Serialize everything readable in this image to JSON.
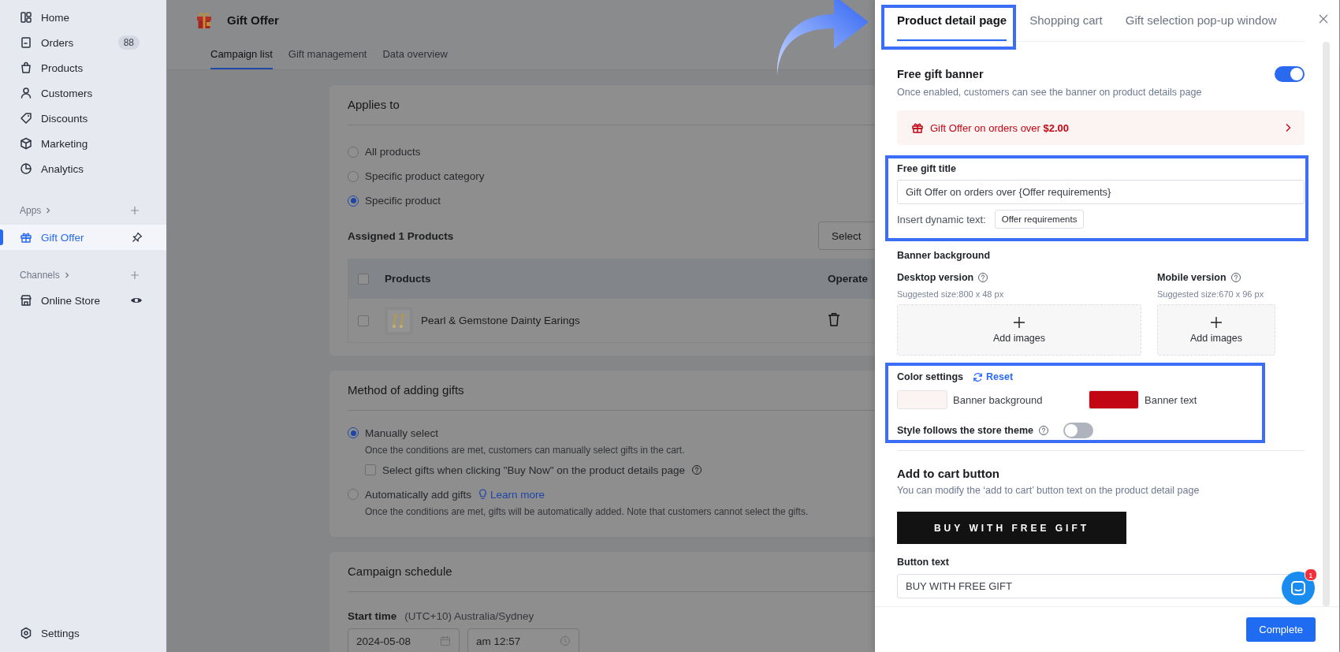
{
  "sidebar": {
    "nav": [
      {
        "label": "Home",
        "selected": false
      },
      {
        "label": "Orders",
        "selected": false,
        "badge": "88"
      },
      {
        "label": "Products",
        "selected": false
      },
      {
        "label": "Customers",
        "selected": false
      },
      {
        "label": "Discounts",
        "selected": false
      },
      {
        "label": "Marketing",
        "selected": false
      },
      {
        "label": "Analytics",
        "selected": false
      }
    ],
    "apps_label": "Apps",
    "apps": [
      {
        "label": "Gift Offer",
        "selected": true
      }
    ],
    "channels_label": "Channels",
    "channels": [
      {
        "label": "Online Store",
        "selected": false
      }
    ],
    "settings": "Settings"
  },
  "header": {
    "title": "Gift Offer",
    "tabs": [
      {
        "label": "Campaign list",
        "selected": true
      },
      {
        "label": "Gift management",
        "selected": false
      },
      {
        "label": "Data overview",
        "selected": false
      }
    ]
  },
  "applies_card": {
    "title": "Applies to",
    "options": [
      {
        "label": "All products",
        "selected": false
      },
      {
        "label": "Specific product category",
        "selected": false
      },
      {
        "label": "Specific product",
        "selected": true
      }
    ],
    "assigned": "Assigned 1 Products",
    "select_button": "Select",
    "table": {
      "header_checked": false,
      "columns": [
        "Products",
        "Operate"
      ],
      "rows": [
        {
          "product": "Pearl & Gemstone Dainty Earings",
          "checked": false
        }
      ]
    }
  },
  "method_card": {
    "title": "Method of adding gifts",
    "options": [
      {
        "label": "Manually select",
        "selected": true,
        "description": "Once the conditions are met, customers can manually select gifts in the cart.",
        "checkbox": {
          "label": "Select gifts when clicking \"Buy Now\" on the product details page",
          "checked": false
        }
      },
      {
        "label": "Automatically add gifts",
        "selected": false,
        "link": "Learn more",
        "description": "Once the conditions are met, gifts will be automatically added. Note that customers cannot select the gifts."
      }
    ]
  },
  "schedule_card": {
    "title": "Campaign schedule",
    "start_label": "Start time",
    "timezone": "(UTC+10) Australia/Sydney",
    "date": "2024-05-08",
    "time": "am 12:57"
  },
  "drawer": {
    "tabs": [
      {
        "label": "Product detail page",
        "selected": true
      },
      {
        "label": "Shopping cart",
        "selected": false
      },
      {
        "label": "Gift selection pop-up window",
        "selected": false
      }
    ],
    "banner": {
      "title": "Free gift banner",
      "description": "Once enabled, customers can see the banner on product details page",
      "on": true,
      "preview": "Gift Offer on orders over **$2.00**"
    },
    "gift_title": {
      "label": "Free gift title",
      "value": "Gift Offer on orders over {Offer requirements}",
      "insert_label": "Insert dynamic text:",
      "chip": "Offer requirements"
    },
    "background": {
      "label": "Banner background",
      "versions": [
        {
          "title": "Desktop version",
          "hint": "Suggested size:800 x 48 px",
          "upload": "Add images"
        },
        {
          "title": "Mobile version",
          "hint": "Suggested size:670 x 96 px",
          "upload": "Add images"
        }
      ]
    },
    "colors": {
      "title": "Color settings",
      "reset": "Reset",
      "swatches": [
        {
          "label": "Banner background",
          "color": "#fcf4f3"
        },
        {
          "label": "Banner text",
          "color": "#c20613"
        }
      ],
      "theme_label": "Style follows the store theme",
      "theme_on": false
    },
    "cart": {
      "title": "Add to cart button",
      "description": "You can modify the ‘add to cart’ button text on the product detail page",
      "preview": "BUY WITH FREE GIFT",
      "field_label": "Button text",
      "value": "BUY WITH FREE GIFT"
    },
    "complete": "Complete",
    "chat_badge": "1"
  }
}
